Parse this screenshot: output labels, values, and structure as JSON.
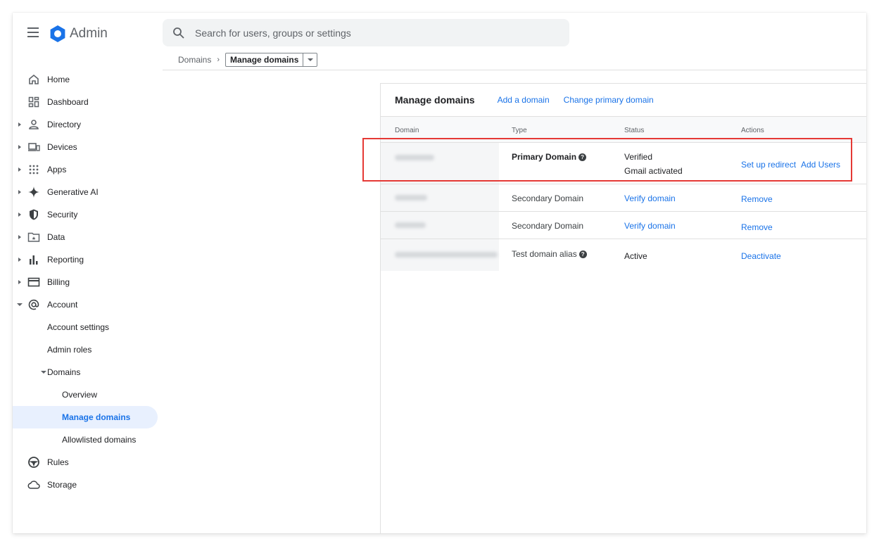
{
  "app": {
    "title": "Admin"
  },
  "search": {
    "placeholder": "Search for users, groups or settings"
  },
  "breadcrumb": {
    "parent": "Domains",
    "separator": "›",
    "current": "Manage domains"
  },
  "sidebar": {
    "items": [
      {
        "label": "Home",
        "icon": "home-icon"
      },
      {
        "label": "Dashboard",
        "icon": "dashboard-icon"
      },
      {
        "label": "Directory",
        "icon": "person-icon"
      },
      {
        "label": "Devices",
        "icon": "devices-icon"
      },
      {
        "label": "Apps",
        "icon": "apps-grid-icon"
      },
      {
        "label": "Generative AI",
        "icon": "sparkle-icon"
      },
      {
        "label": "Security",
        "icon": "shield-icon"
      },
      {
        "label": "Data",
        "icon": "folder-icon"
      },
      {
        "label": "Reporting",
        "icon": "bar-chart-icon"
      },
      {
        "label": "Billing",
        "icon": "credit-card-icon"
      },
      {
        "label": "Account",
        "icon": "at-sign-icon"
      },
      {
        "label": "Account settings"
      },
      {
        "label": "Admin roles"
      },
      {
        "label": "Domains"
      },
      {
        "label": "Overview"
      },
      {
        "label": "Manage domains"
      },
      {
        "label": "Allowlisted domains"
      },
      {
        "label": "Rules",
        "icon": "steering-wheel-icon"
      },
      {
        "label": "Storage",
        "icon": "cloud-icon"
      }
    ]
  },
  "panel": {
    "title": "Manage domains",
    "add_domain": "Add a domain",
    "change_primary": "Change primary domain",
    "columns": {
      "domain": "Domain",
      "type": "Type",
      "status": "Status",
      "actions": "Actions"
    },
    "rows": [
      {
        "type": "Primary Domain",
        "status": "Verified",
        "status2": "Gmail activated",
        "action1": "Set up redirect",
        "action2": "Add Users"
      },
      {
        "type": "Secondary Domain",
        "status": "Verify domain",
        "action1": "Remove"
      },
      {
        "type": "Secondary Domain",
        "status": "Verify domain",
        "action1": "Remove"
      },
      {
        "type": "Test domain alias",
        "status": "Active",
        "action1": "Deactivate"
      }
    ]
  },
  "colors": {
    "accent": "#1a73e8",
    "highlight": "#e53935",
    "active_bg": "#e8f0fe"
  }
}
